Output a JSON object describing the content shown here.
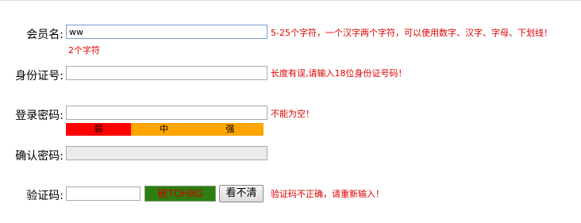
{
  "fields": {
    "username": {
      "label": "会员名:",
      "value": "ww",
      "hint": "5-25个字符，一个汉字两个字符，可以使用数字、汉字、字母、下划线！",
      "sub_hint": "2个字符"
    },
    "id_number": {
      "label": "身份证号:",
      "value": "",
      "hint": "长度有误,请输入18位身份证号码！"
    },
    "password": {
      "label": "登录密码:",
      "value": "",
      "hint": "不能为空！",
      "strength": {
        "weak": "弱",
        "medium": "中",
        "strong": "强"
      }
    },
    "confirm_password": {
      "label": "确认密码:",
      "value": ""
    },
    "captcha": {
      "label": "验证码:",
      "value": "",
      "code": "被TOH8G",
      "refresh_button": "看不清",
      "hint": "验证码不正确，请重新输入！"
    }
  },
  "colors": {
    "error_text": "#e00000",
    "strength_weak": "#ff0000",
    "strength_active": "#ffa500",
    "captcha_bg": "#2e7d12"
  }
}
